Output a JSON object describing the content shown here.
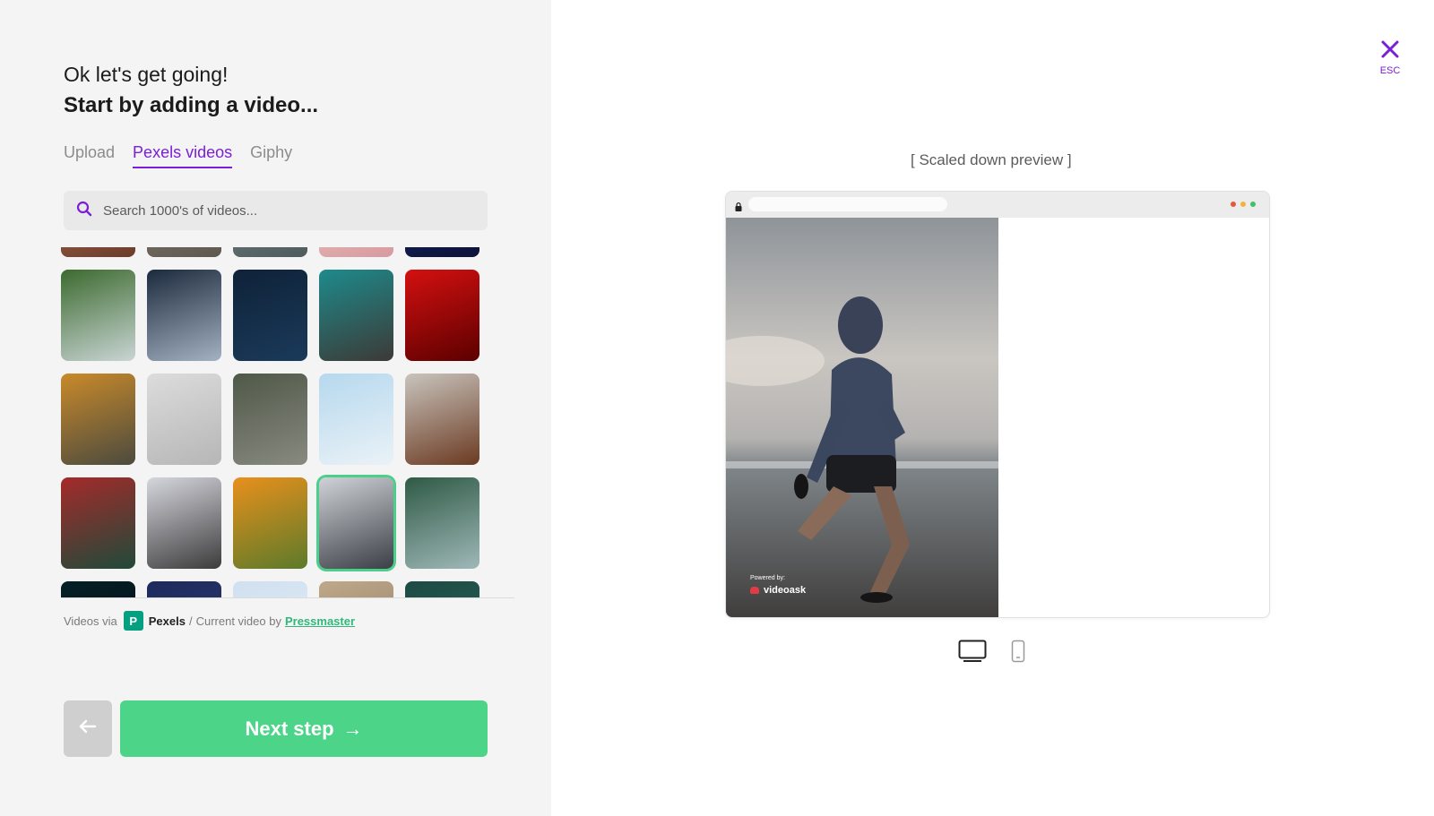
{
  "header": {
    "intro": "Ok let's get going!",
    "headline": "Start by adding a video..."
  },
  "tabs": [
    {
      "label": "Upload",
      "active": false
    },
    {
      "label": "Pexels videos",
      "active": true
    },
    {
      "label": "Giphy",
      "active": false
    }
  ],
  "search": {
    "placeholder": "Search 1000's of videos...",
    "value": ""
  },
  "video_grid": {
    "selected_index": 18,
    "thumbnails": [
      {
        "subject": "hand",
        "colors": [
          "#b77a5e",
          "#6b3b2a"
        ]
      },
      {
        "subject": "stone",
        "colors": [
          "#8a8278",
          "#5f584f"
        ]
      },
      {
        "subject": "rocks",
        "colors": [
          "#7d8d8e",
          "#4e5b5c"
        ]
      },
      {
        "subject": "flower",
        "colors": [
          "#f2d2c4",
          "#d79aa0"
        ]
      },
      {
        "subject": "night sky",
        "colors": [
          "#1c2a6e",
          "#0b1239"
        ]
      },
      {
        "subject": "waterfall",
        "colors": [
          "#3c6a2f",
          "#c9d5d4"
        ]
      },
      {
        "subject": "mountain",
        "colors": [
          "#1c2a3d",
          "#a3b1c2"
        ]
      },
      {
        "subject": "earth at night",
        "colors": [
          "#0f2238",
          "#1a3a5a"
        ]
      },
      {
        "subject": "coast aerial",
        "colors": [
          "#1e8a8c",
          "#3c3a36"
        ]
      },
      {
        "subject": "red fabric",
        "colors": [
          "#d41010",
          "#5c0000"
        ]
      },
      {
        "subject": "autumn road",
        "colors": [
          "#c98a2a",
          "#4b4a3f"
        ]
      },
      {
        "subject": "people walking",
        "colors": [
          "#dcdcdc",
          "#b6b6b6"
        ]
      },
      {
        "subject": "crosswalk",
        "colors": [
          "#4f5848",
          "#888a80"
        ]
      },
      {
        "subject": "light bulb",
        "colors": [
          "#b6d8ee",
          "#eaf2f7"
        ]
      },
      {
        "subject": "ocean rocks",
        "colors": [
          "#c9c4bd",
          "#6b3a22"
        ]
      },
      {
        "subject": "abstract smoke",
        "colors": [
          "#a52a2a",
          "#1f4a3a"
        ]
      },
      {
        "subject": "plaid shirt",
        "colors": [
          "#d6d6de",
          "#3c3c3c"
        ]
      },
      {
        "subject": "butterfly",
        "colors": [
          "#e8901c",
          "#5c7a2a"
        ]
      },
      {
        "subject": "runner",
        "colors": [
          "#cfd2d6",
          "#3b3f46"
        ]
      },
      {
        "subject": "river aerial",
        "colors": [
          "#2f5a45",
          "#9fb8b8"
        ]
      },
      {
        "subject": "lights",
        "colors": [
          "#042025",
          "#0a0a1a"
        ]
      },
      {
        "subject": "sky",
        "colors": [
          "#1d2a5c",
          "#2e3d73"
        ]
      },
      {
        "subject": "clouds",
        "colors": [
          "#cfe0f0",
          "#e8eef5"
        ]
      },
      {
        "subject": "sand",
        "colors": [
          "#bfa88a",
          "#8d7b64"
        ]
      },
      {
        "subject": "forest",
        "colors": [
          "#1c4a44",
          "#2d6a5a"
        ]
      }
    ]
  },
  "credits": {
    "prefix": "Videos via",
    "logo_letter": "P",
    "provider": "Pexels",
    "separator": "/",
    "current_prefix": "Current video by",
    "author": "Pressmaster"
  },
  "actions": {
    "back_icon": "arrow-left-icon",
    "next_label": "Next step",
    "next_arrow": "→"
  },
  "close": {
    "icon": "close-icon",
    "label": "ESC"
  },
  "preview": {
    "label": "[ Scaled down preview ]",
    "powered_by": "Powered by:",
    "brand": "videoask",
    "window_dots": [
      "#e8573b",
      "#f0b43c",
      "#3fc06b"
    ]
  },
  "devices": [
    {
      "name": "desktop-icon",
      "active": true
    },
    {
      "name": "mobile-icon",
      "active": false
    }
  ],
  "colors": {
    "accent": "#7a1fd6",
    "primary_button": "#4cd588",
    "selected_border": "#4ccf8a",
    "link": "#2fb879"
  }
}
